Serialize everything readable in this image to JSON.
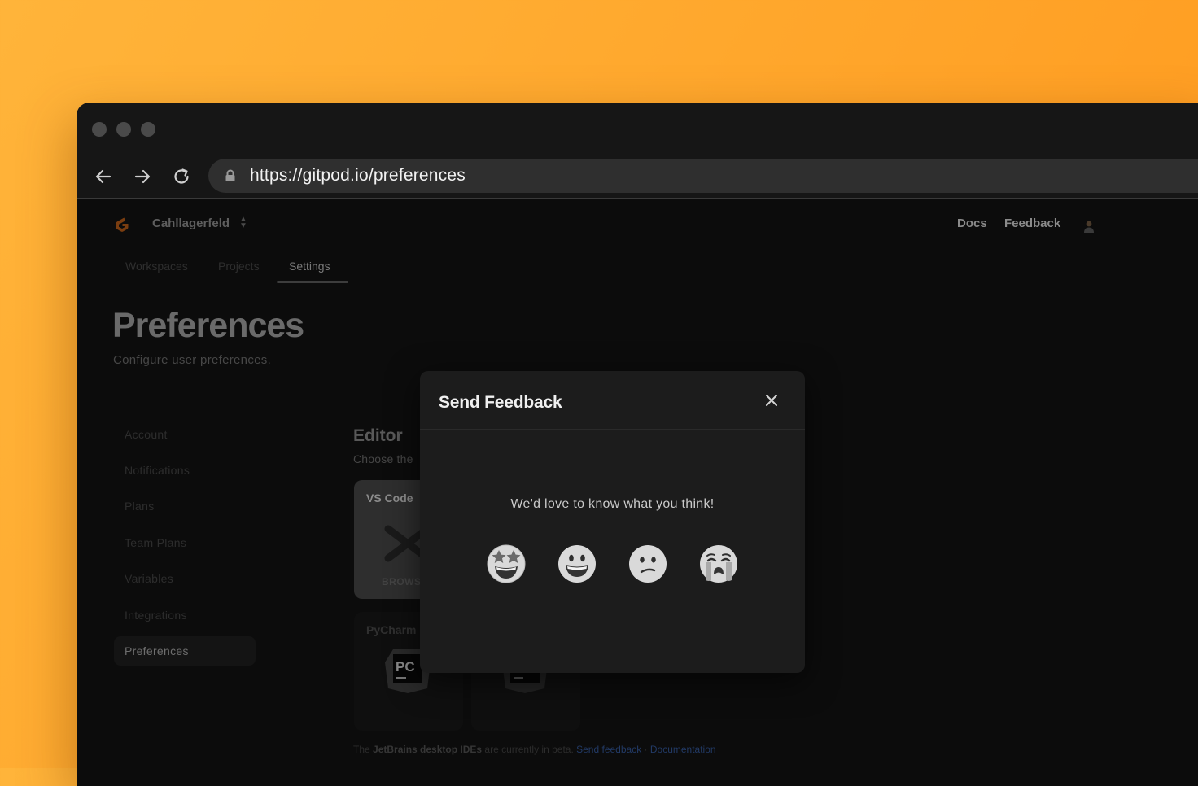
{
  "browser": {
    "url": "https://gitpod.io/preferences"
  },
  "header": {
    "org_name": "Cahllagerfeld",
    "links": {
      "docs": "Docs",
      "feedback": "Feedback"
    }
  },
  "tabs": [
    {
      "label": "Workspaces",
      "active": false
    },
    {
      "label": "Projects",
      "active": false
    },
    {
      "label": "Settings",
      "active": true
    }
  ],
  "page": {
    "title": "Preferences",
    "subtitle": "Configure user preferences."
  },
  "sidebar": {
    "items": [
      {
        "label": "Account"
      },
      {
        "label": "Notifications"
      },
      {
        "label": "Plans"
      },
      {
        "label": "Team Plans"
      },
      {
        "label": "Variables"
      },
      {
        "label": "Integrations"
      },
      {
        "label": "Preferences",
        "active": true
      }
    ]
  },
  "editor": {
    "title": "Editor",
    "subtitle": "Choose the",
    "cards": [
      {
        "name": "VS Code",
        "badge": "BROWS",
        "selected": true
      },
      {
        "name": "PyCharm",
        "badge": "PC",
        "selected": false
      }
    ],
    "footnote": {
      "pre": "The ",
      "bold": "JetBrains desktop IDEs",
      "post": " are currently in beta. ",
      "link1": "Send feedback",
      "sep": " · ",
      "link2": "Documentation"
    }
  },
  "modal": {
    "title": "Send Feedback",
    "prompt": "We'd love to know what you think!",
    "emojis": [
      "star-struck-icon",
      "grinning-face-icon",
      "confused-face-icon",
      "crying-face-icon"
    ]
  }
}
